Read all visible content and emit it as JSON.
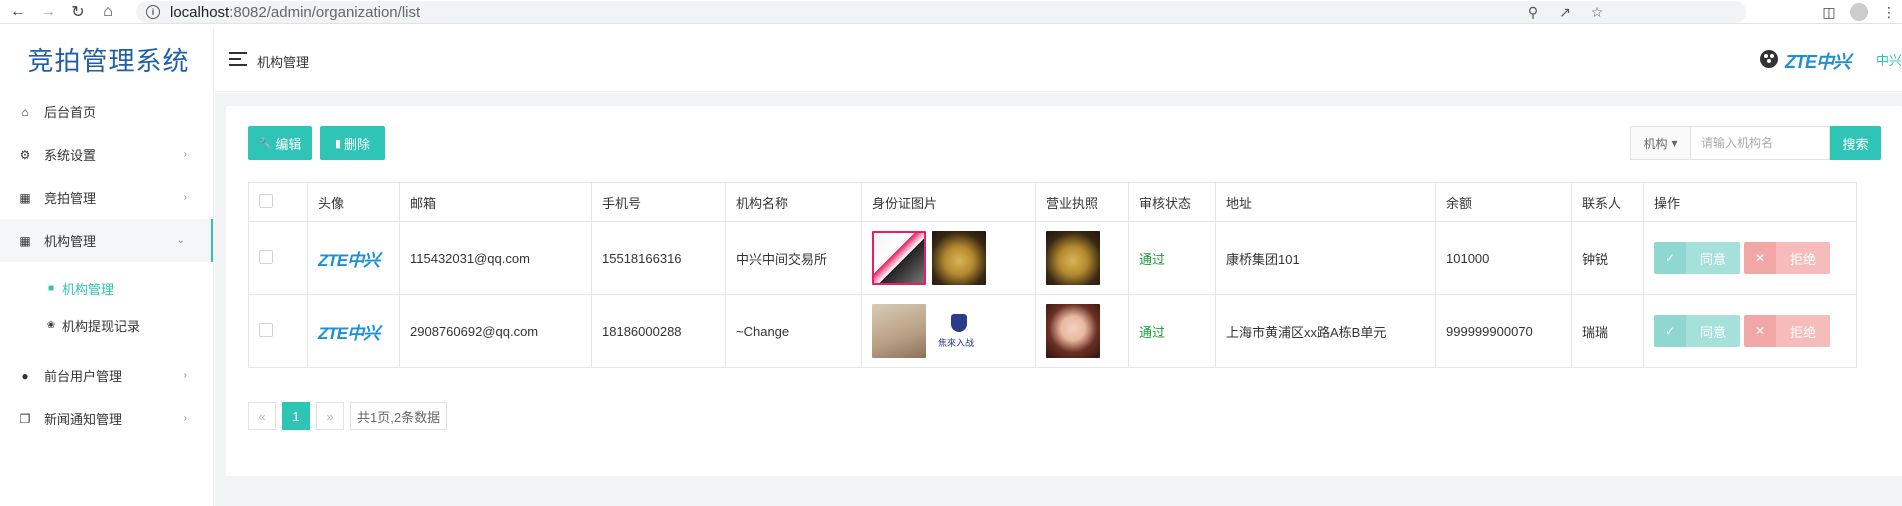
{
  "browser": {
    "url_host": "localhost",
    "url_path": ":8082/admin/organization/list"
  },
  "sidebar": {
    "logo": "竞拍管理系统",
    "items": [
      {
        "label": "后台首页",
        "icon": "home-icon"
      },
      {
        "label": "系统设置",
        "icon": "gear-icon"
      },
      {
        "label": "竞拍管理",
        "icon": "nodes-icon"
      },
      {
        "label": "机构管理",
        "icon": "grid-icon"
      },
      {
        "label": "前台用户管理",
        "icon": "users-icon"
      },
      {
        "label": "新闻通知管理",
        "icon": "copy-icon"
      }
    ],
    "sub_items": [
      {
        "label": "机构管理"
      },
      {
        "label": "机构提现记录"
      }
    ]
  },
  "header": {
    "breadcrumb": "机构管理",
    "logo": "ZTE中兴",
    "user": "中兴"
  },
  "toolbar": {
    "edit_label": "编辑",
    "delete_label": "删除",
    "search_field": "机构",
    "search_placeholder": "请输入机构名",
    "search_label": "搜索"
  },
  "table": {
    "headers": [
      "头像",
      "邮箱",
      "手机号",
      "机构名称",
      "身份证图片",
      "营业执照",
      "审核状态",
      "地址",
      "余额",
      "联系人",
      "操作"
    ],
    "rows": [
      {
        "avatar": "ZTE中兴",
        "email": "115432031@qq.com",
        "phone": "15518166316",
        "name": "中兴中间交易所",
        "status": "通过",
        "address": "康桥集团101",
        "balance": "101000",
        "contact": "钟锐",
        "agree": "同意",
        "reject": "拒绝"
      },
      {
        "avatar": "ZTE中兴",
        "email": "2908760692@qq.com",
        "phone": "18186000288",
        "name": "~Change",
        "status": "通过",
        "address": "上海市黄浦区xx路A栋B单元",
        "balance": "999999900070",
        "contact": "瑞瑞",
        "agree": "同意",
        "reject": "拒绝"
      }
    ]
  },
  "pager": {
    "prev": "«",
    "current": "1",
    "next": "»",
    "info": "共1页,2条数据"
  },
  "colors": {
    "accent": "#2ec4b6",
    "logo_blue": "#1f5ea8",
    "status_green": "#1c9b3a"
  }
}
